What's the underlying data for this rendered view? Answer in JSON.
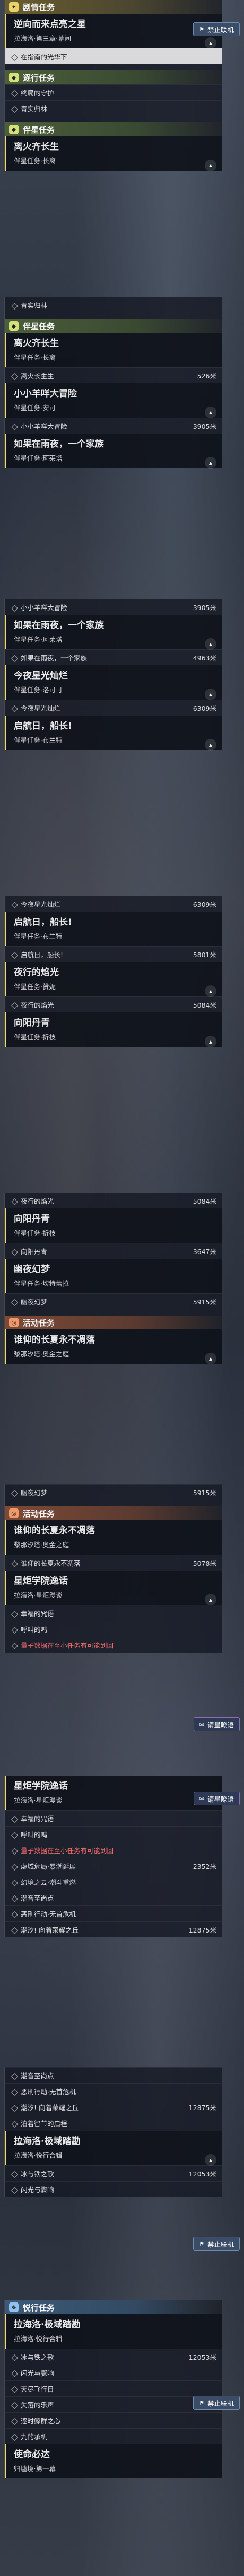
{
  "quests": {
    "q1": {
      "title": "逆向而来点亮之星",
      "sub": "拉海洛·第三章·幕间"
    },
    "q2": {
      "title": "离火齐长生",
      "sub": "伴星任务·长离"
    },
    "q3": {
      "title": "小小羊咩大冒险",
      "sub": "伴星任务·安可"
    },
    "q4": {
      "title": "如果在雨夜，一个家族",
      "sub": "伴星任务·珂莱塔"
    },
    "q5": {
      "title": "今夜星光灿烂",
      "sub": "伴星任务·洛可可"
    },
    "q6": {
      "title": "启航日，船长!",
      "sub": "伴星任务·布兰特"
    },
    "q7": {
      "title": "夜行的焰光",
      "sub": "伴星任务·赞妮"
    },
    "q8": {
      "title": "向阳丹青",
      "sub": "伴星任务·折枝"
    },
    "q9": {
      "title": "幽夜幻梦",
      "sub": "伴星任务·坎特蕾拉"
    },
    "q10": {
      "title": "谁仰的长夏永不凋落",
      "sub": "黎那汐塔·奥金之庭"
    },
    "q11": {
      "title": "星炬学院逸话",
      "sub": "拉海洛·星炬漫谈"
    },
    "q12": {
      "title": "拉海洛·极域踏勘",
      "sub": "拉海洛·悦行合辑"
    },
    "q13": {
      "title": "使命必达",
      "sub": "归墟境·第一幕"
    }
  },
  "steps": {
    "s_dst": "在指南的光华下",
    "s_shouhu": "终局的守护",
    "s_qingshi": "青实归林",
    "s_lihuo": "离火长生生",
    "s_yang": "小小羊咩大冒险",
    "s_yuye": "如果在雨夜，一个家族",
    "s_xingguang": "今夜星光灿烂",
    "s_qihang": "启航日，船长!",
    "s_yanguang": "夜行的焰光",
    "s_danqing": "向阳丹青",
    "s_youye": "幽夜幻梦",
    "s_changxia": "谁仰的长夏永不凋落",
    "s_xingju1": "幸福的咒语",
    "s_hao": "呼叫的鸣",
    "s_haored": "量子数据在至小任务有可能到回",
    "s_xuji": "虚域危局·暴潮延展",
    "s_huanxiang": "幻境之云·潮斗重燃",
    "s_youyue": "潮音至尚点",
    "s_ebi": "恶刑行动·无首危机",
    "s_chaoyin": "潮汐! 向着荣耀之丘",
    "s_daxian": "泊着智节的启程",
    "s_bing": "冰与铁之歌",
    "s_shan": "闪光与骤响",
    "s_wandao": "天尽飞行日",
    "s_xieshi": "失落的乐声",
    "s_mingshen": "逐时鲸群之心",
    "s_danmu": "九的承机"
  },
  "dist": {
    "d526": "526米",
    "d3905": "3905米",
    "d4963": "4963米",
    "d6309": "6309米",
    "d5801": "5801米",
    "d5084": "5084米",
    "d3647": "3647米",
    "d5915": "5915米",
    "d5078": "5078米",
    "d2352": "2352米",
    "d12875": "12875米",
    "d12053": "12053米"
  },
  "labels": {
    "story": "剧情任务",
    "comp": "伴星任务",
    "event": "活动任务",
    "side": "悦行任务",
    "fwd": "逐行任务",
    "no_connect": "禁止联机",
    "request": "请星瞭语",
    "expand": "▴"
  },
  "colors": {
    "story": "#e8d26a",
    "comp": "#d6e07a",
    "event": "#f09a6a",
    "side": "#8fc0f0"
  }
}
